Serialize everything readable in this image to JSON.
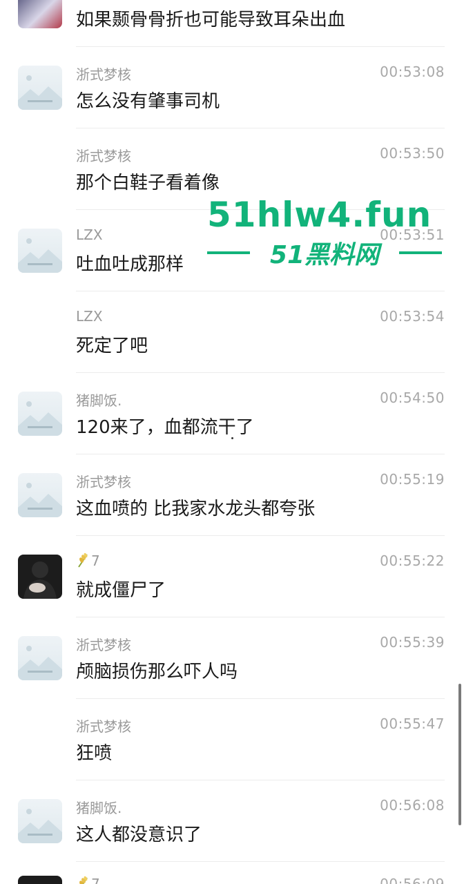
{
  "messages": [
    {
      "sender": "",
      "time": "",
      "content": "如果颞骨骨折也可能导致耳朵出血",
      "avatar": "anime-avatar"
    },
    {
      "sender": "浙式梦核",
      "time": "00:53:08",
      "content": "怎么没有肇事司机",
      "avatar": "placeholder-image-avatar"
    },
    {
      "sender": "浙式梦核",
      "time": "00:53:50",
      "content": "那个白鞋子看着像",
      "avatar": "none"
    },
    {
      "sender": "LZX",
      "time": "00:53:51",
      "content": "吐血吐成那样",
      "avatar": "placeholder-image-avatar"
    },
    {
      "sender": "LZX",
      "time": "00:53:54",
      "content": "死定了吧",
      "avatar": "none"
    },
    {
      "sender": "猪脚饭.",
      "time": "00:54:50",
      "content": "120来了，血都流干了",
      "avatar": "placeholder-image-avatar"
    },
    {
      "sender": "浙式梦核",
      "time": "00:55:19",
      "content": "这血喷的 比我家水龙头都夸张",
      "avatar": "placeholder-image-avatar"
    },
    {
      "sender": "7",
      "time": "00:55:22",
      "content": "就成僵尸了",
      "avatar": "dark-photo-avatar",
      "sender_icon": "wheat-icon"
    },
    {
      "sender": "浙式梦核",
      "time": "00:55:39",
      "content": "颅脑损伤那么吓人吗",
      "avatar": "placeholder-image-avatar"
    },
    {
      "sender": "浙式梦核",
      "time": "00:55:47",
      "content": "狂喷",
      "avatar": "none"
    },
    {
      "sender": "猪脚饭.",
      "time": "00:56:08",
      "content": "这人都没意识了",
      "avatar": "placeholder-image-avatar"
    },
    {
      "sender": "7",
      "time": "00:56:09",
      "content": "",
      "avatar": "dark-photo-avatar",
      "sender_icon": "wheat-icon"
    }
  ],
  "watermark": {
    "url": "51hlw4.fun",
    "name": "51黑料网"
  },
  "colors": {
    "accent": "#12b37a",
    "time": "#a8a8a8",
    "sender": "#9a9a9a",
    "text": "#1a1a1a"
  }
}
